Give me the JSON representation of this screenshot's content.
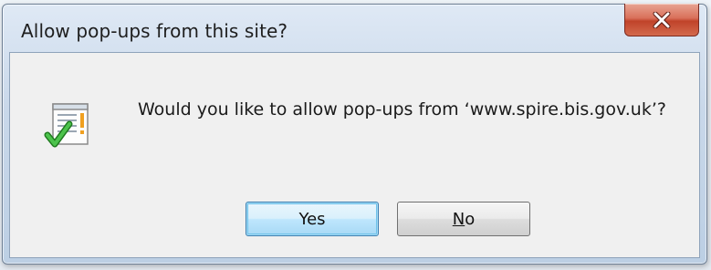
{
  "dialog": {
    "title": "Allow pop-ups from this site?",
    "message": "Would you like to allow pop-ups from ‘www.spire.bis.gov.uk’?",
    "icon": "popup-allow-icon",
    "close_icon": "close-icon",
    "buttons": {
      "yes_label": "Yes",
      "no_accel": "N",
      "no_rest": "o"
    }
  },
  "colors": {
    "close_button": "#c0432a",
    "default_button_border": "#3c7fb1",
    "check_green": "#2f9e2f",
    "warning_orange": "#f0a020"
  }
}
